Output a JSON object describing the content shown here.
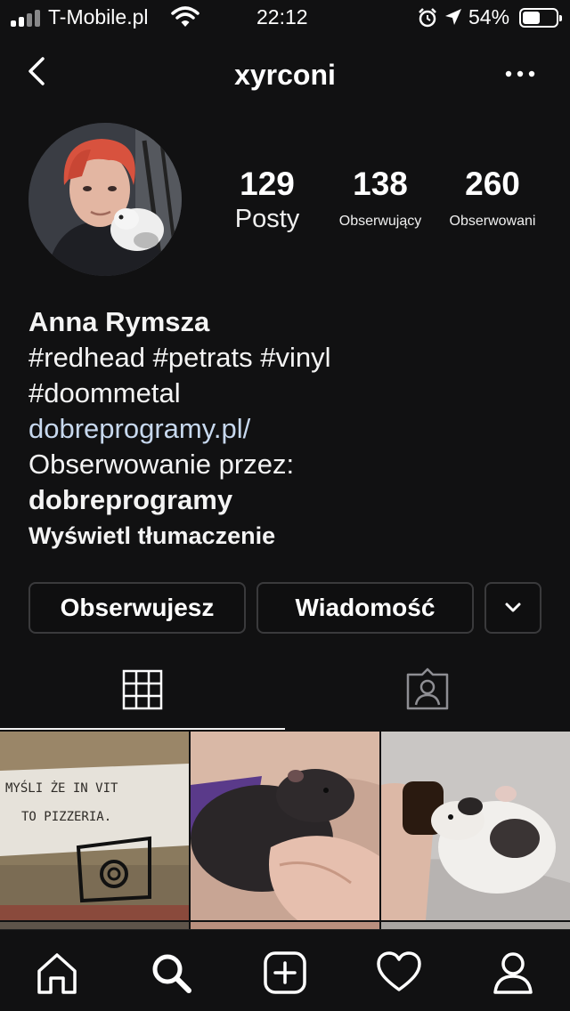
{
  "status_bar": {
    "carrier": "T-Mobile.pl",
    "time": "22:12",
    "battery": "54%",
    "battery_level": 0.54
  },
  "header": {
    "username": "xyrconi",
    "icons": [
      "back-arrow-icon",
      "more-options-icon"
    ]
  },
  "stats": [
    {
      "value": "129",
      "label": "Posty"
    },
    {
      "value": "138",
      "label": "Obserwujący"
    },
    {
      "value": "260",
      "label": "Obserwowani"
    }
  ],
  "bio": {
    "name": "Anna Rymsza",
    "hashtags_line1": "#redhead #petrats #vinyl",
    "hashtags_line2": "#doommetal",
    "link": "dobreprogramy.pl/",
    "followed_by_label": "Obserwowanie przez:",
    "followed_by_user": "dobreprogramy",
    "translate": "Wyświetl tłumaczenie"
  },
  "buttons": {
    "following": "Obserwujesz",
    "message": "Wiadomość"
  },
  "photos": [
    {
      "text": "MYŚLI ŻE IN VIT",
      "text2": "TO PIZZERIA."
    },
    {},
    {}
  ],
  "colors": {
    "background": "#111112",
    "link": "#c7d8ee",
    "button_border": "#3a3a3c"
  }
}
